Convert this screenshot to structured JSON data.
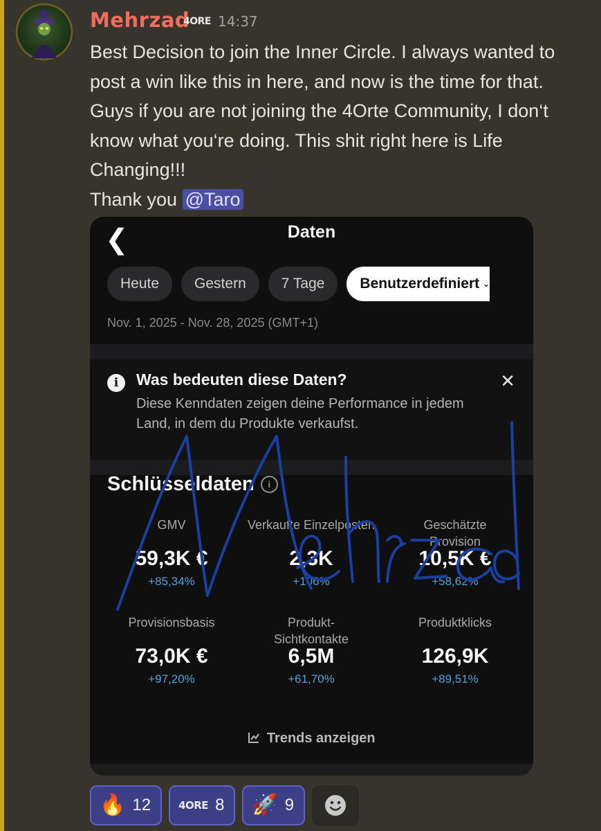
{
  "message": {
    "author": "Mehrzad",
    "guild_tag": "4ORE",
    "time": "14:37",
    "lines": [
      "Best Decision to join the Inner Circle. I always wanted to post a win like this in here, and now is the time for that. Guys if you are not joining the 4Orte Community, I don‘t know what you‘re doing. This shit right here is Life Changing!!!",
      "Thank you"
    ],
    "mention": "@Taro"
  },
  "screenshot": {
    "title": "Daten",
    "chips": [
      "Heute",
      "Gestern",
      "7 Tage",
      "Benutzerdefiniert"
    ],
    "date_range": "Nov. 1, 2025 - Nov. 28, 2025 (GMT+1)",
    "info_title": "Was bedeuten diese Daten?",
    "info_text": "Diese Kenndaten zeigen deine Performance in jedem Land, in dem du Produkte verkaufst.",
    "section_title": "Schlüsseldaten",
    "metrics": [
      {
        "label": "GMV",
        "value": "59,3K €",
        "change": "+85,34%"
      },
      {
        "label": "Verkaufte Einzelposten",
        "value": "2,3K",
        "change": "+106%"
      },
      {
        "label": "Geschätzte Provision",
        "value": "10,5K €",
        "change": "+58,62%"
      },
      {
        "label": "Provisionsbasis",
        "value": "73,0K €",
        "change": "+97,20%"
      },
      {
        "label": "Produkt-Sichtkontakte",
        "value": "6,5M",
        "change": "+61,70%"
      },
      {
        "label": "Produktklicks",
        "value": "126,9K",
        "change": "+89,51%"
      }
    ],
    "trends_label": "Trends anzeigen",
    "signature_text": "Mehrzad"
  },
  "reactions": [
    {
      "emoji": "🔥",
      "count": "12"
    },
    {
      "emoji": "4ORE",
      "count": "8"
    },
    {
      "emoji": "🚀",
      "count": "9"
    }
  ],
  "colors": {
    "author": "#f26d5b",
    "mention_bg": "#4b4fa3",
    "change": "#4aa3d9",
    "reaction_bg": "#3c3f86",
    "signature": "#1b3fa0"
  }
}
